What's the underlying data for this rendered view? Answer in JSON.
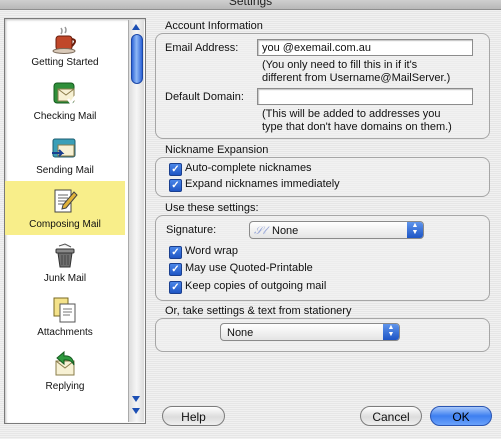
{
  "window": {
    "title": "Settings"
  },
  "sidebar": {
    "items": [
      {
        "label": "Getting Started",
        "icon": "coffee-cup-icon",
        "selected": false
      },
      {
        "label": "Checking Mail",
        "icon": "mailbox-check-icon",
        "selected": false
      },
      {
        "label": "Sending Mail",
        "icon": "mail-send-icon",
        "selected": false
      },
      {
        "label": "Composing Mail",
        "icon": "compose-pen-icon",
        "selected": true
      },
      {
        "label": "Junk Mail",
        "icon": "trash-can-icon",
        "selected": false
      },
      {
        "label": "Attachments",
        "icon": "attachment-doc-icon",
        "selected": false
      },
      {
        "label": "Replying",
        "icon": "reply-arrow-icon",
        "selected": false
      }
    ]
  },
  "account": {
    "section_title": "Account Information",
    "email_label": "Email Address:",
    "email_value": "you  @exemail.com.au",
    "email_note_1": "(You only need to fill this in if it's",
    "email_note_2": "different from Username@MailServer.)",
    "domain_label": "Default Domain:",
    "domain_value": "",
    "domain_note_1": "(This will be added to addresses you",
    "domain_note_2": "type that don't have domains on them.)"
  },
  "nickname": {
    "section_title": "Nickname Expansion",
    "autocomplete_label": "Auto-complete nicknames",
    "expand_label": "Expand nicknames immediately"
  },
  "settings": {
    "section_title": "Use these settings:",
    "signature_label": "Signature:",
    "signature_value": "None",
    "word_wrap_label": "Word wrap",
    "quoted_printable_label": "May use Quoted-Printable",
    "keep_copies_label": "Keep copies of outgoing mail"
  },
  "stationery": {
    "section_title": "Or, take settings & text from stationery",
    "value": "None"
  },
  "buttons": {
    "help": "Help",
    "cancel": "Cancel",
    "ok": "OK"
  },
  "colors": {
    "selected_item_bg": "#f8ee8a",
    "accent": "#2f66d8"
  }
}
